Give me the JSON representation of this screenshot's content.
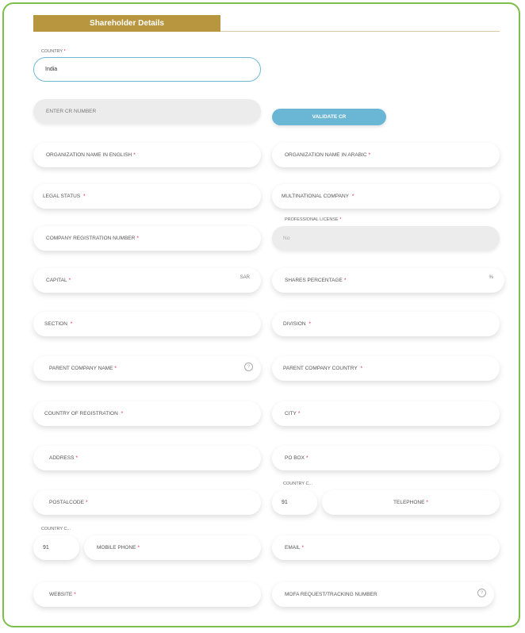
{
  "section_tab": "Shareholder Details",
  "country": {
    "label": "COUNTRY",
    "required": "*",
    "value": "India"
  },
  "cr_number": {
    "placeholder": "ENTER CR NUMBER"
  },
  "validate_button": "VALIDATE CR",
  "fields": {
    "org_name_en": {
      "label": "ORGANIZATION NAME IN ENGLISH",
      "req": "*"
    },
    "org_name_ar": {
      "label": "ORGANIZATION NAME IN ARABIC",
      "req": "*"
    },
    "legal_status": {
      "label": "LEGAL STATUS",
      "req": "*"
    },
    "multinational": {
      "label": "MULTINATIONAL COMPANY",
      "req": "*"
    },
    "company_reg_number": {
      "label": "COMPANY REGISTRATION NUMBER",
      "req": "*"
    },
    "professional_license": {
      "label": "PROFESSIONAL LICENSE",
      "req": "*",
      "value": "No"
    },
    "capital": {
      "label": "CAPITAL",
      "req": "*",
      "suffix": "SAR"
    },
    "shares_percentage": {
      "label": "SHARES PERCENTAGE",
      "req": "*",
      "suffix": "%"
    },
    "section": {
      "label": "SECTION",
      "req": "*"
    },
    "division": {
      "label": "DIVISION",
      "req": "*"
    },
    "parent_company_name": {
      "label": "PARENT COMPANY NAME",
      "req": "*",
      "help": "?"
    },
    "parent_company_country": {
      "label": "PARENT COMPANY COUNTRY",
      "req": "*"
    },
    "country_of_registration": {
      "label": "COUNTRY OF REGISTRATION",
      "req": "*"
    },
    "city": {
      "label": "CITY",
      "req": "*"
    },
    "address": {
      "label": "ADDRESS",
      "req": "*"
    },
    "po_box": {
      "label": "PO BOX",
      "req": "*"
    },
    "postal_code": {
      "label": "POSTALCODE",
      "req": "*"
    },
    "telephone": {
      "label": "TELEPHONE",
      "req": "*",
      "country_code_label": "COUNTRY C...",
      "country_code": "91"
    },
    "mobile_phone": {
      "label": "MOBILE PHONE",
      "req": "*",
      "country_code_label": "COUNTRY C...",
      "country_code": "91"
    },
    "email": {
      "label": "EMAIL",
      "req": "*"
    },
    "website": {
      "label": "WEBSITE",
      "req": "*"
    },
    "mofa_request": {
      "label": "MOFA REQUEST/TRACKING NUMBER",
      "help": "?"
    }
  }
}
